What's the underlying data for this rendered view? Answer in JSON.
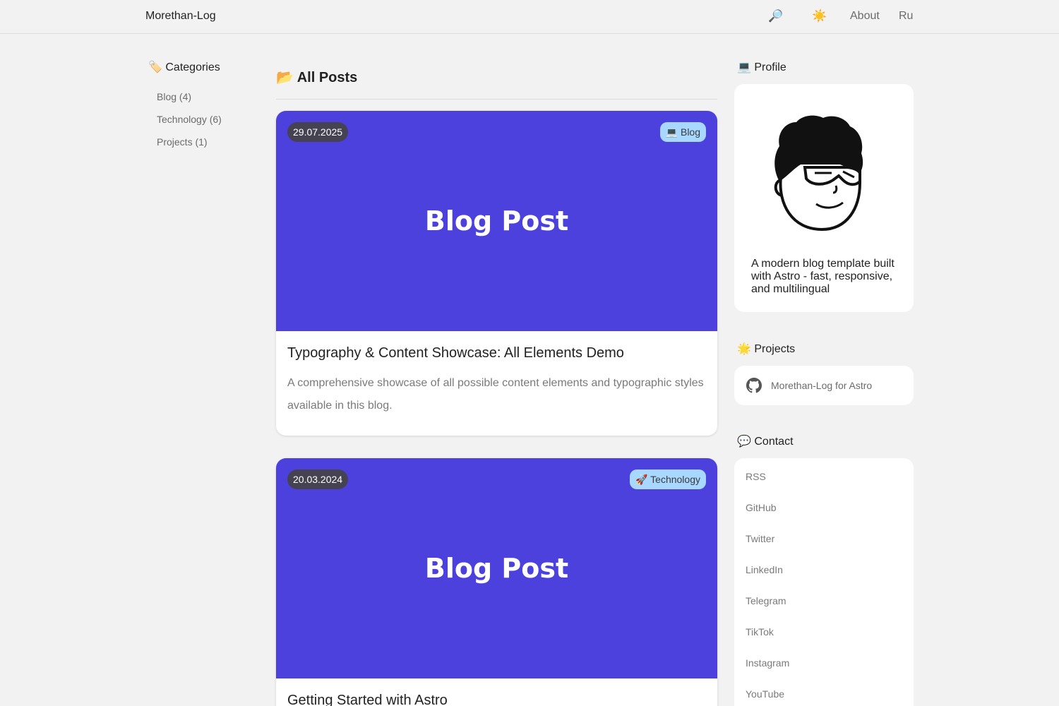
{
  "header": {
    "brand": "Morethan-Log",
    "search_icon": "🔎",
    "theme_icon": "☀️",
    "about": "About",
    "lang": "Ru"
  },
  "categories": {
    "title": "🏷️ Categories",
    "items": [
      {
        "label": "Blog (4)"
      },
      {
        "label": "Technology (6)"
      },
      {
        "label": "Projects (1)"
      }
    ]
  },
  "main": {
    "title": "📂 All Posts",
    "posts": [
      {
        "date": "29.07.2025",
        "category": "💻 Blog",
        "cover_text": "Blog Post",
        "title": "Typography & Content Showcase: All Elements Demo",
        "description": "A comprehensive showcase of all possible content elements and typographic styles available in this blog."
      },
      {
        "date": "20.03.2024",
        "category": "🚀 Technology",
        "cover_text": "Blog Post",
        "title": "Getting Started with Astro",
        "description": ""
      }
    ]
  },
  "profile": {
    "title": "💻 Profile",
    "avatar_icon": "avatar-illustration",
    "bio": "A modern blog template built with Astro - fast, responsive, and multilingual"
  },
  "projects": {
    "title": "🌟 Projects",
    "items": [
      {
        "label": "Morethan-Log for Astro",
        "icon": "github-icon"
      }
    ]
  },
  "contact": {
    "title": "💬 Contact",
    "links": [
      {
        "label": "RSS"
      },
      {
        "label": "GitHub"
      },
      {
        "label": "Twitter"
      },
      {
        "label": "LinkedIn"
      },
      {
        "label": "Telegram"
      },
      {
        "label": "TikTok"
      },
      {
        "label": "Instagram"
      },
      {
        "label": "YouTube"
      }
    ]
  },
  "colors": {
    "background": "#f2f2f2",
    "cover": "#4c41dc",
    "date_badge": "#454352",
    "category_badge": "#a8d8ff"
  }
}
